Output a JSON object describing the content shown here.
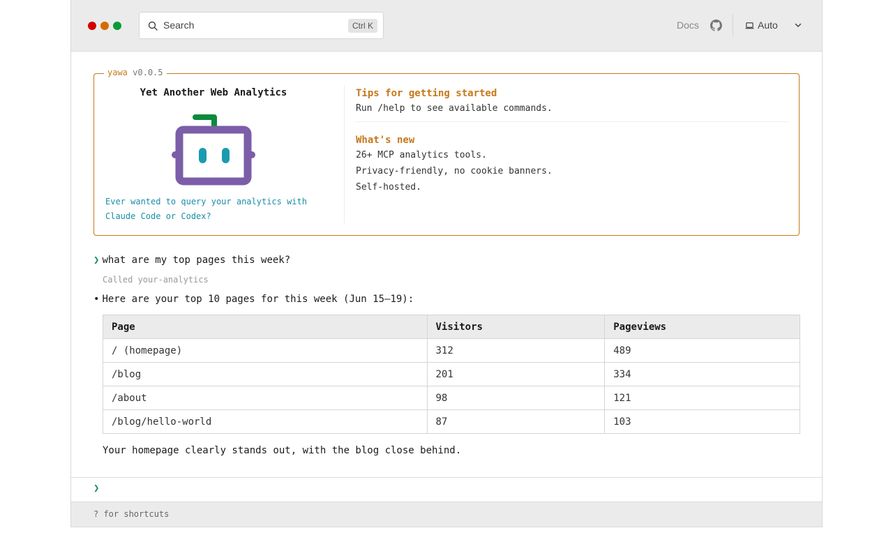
{
  "titlebar": {
    "window_controls": [
      {
        "name": "close",
        "color": "#d40000"
      },
      {
        "name": "minimize",
        "color": "#d46b00"
      },
      {
        "name": "maximize",
        "color": "#0a9a3a"
      }
    ],
    "search": {
      "placeholder": "Search",
      "icon": "search-icon",
      "shortcut": "Ctrl K"
    },
    "docs_label": "Docs",
    "github_icon": "github-icon",
    "theme": {
      "icon": "laptop-icon",
      "label": "Auto",
      "chevron": "chevron-down-icon"
    }
  },
  "welcome": {
    "app_name": "yawa",
    "version": "v0.0.5",
    "title": "Yet Another Web Analytics",
    "tagline": "Ever wanted to query your analytics with Claude Code or Codex?",
    "tips_heading": "Tips for getting started",
    "tips_lines": [
      "Run /help to see available commands."
    ],
    "news_heading": "What's new",
    "news_lines": [
      "26+ MCP analytics tools.",
      "Privacy-friendly, no cookie banners.",
      "Self-hosted."
    ],
    "colors": {
      "border": "#c7781a",
      "accent": "#c7781a",
      "tagline": "#1a8fa8",
      "robot_body": "#7b5ea7",
      "robot_eyes": "#1a9bb0",
      "robot_antenna": "#0a8a3a"
    }
  },
  "conversation": {
    "prompt": "what are my top pages this week?",
    "tool_call": "Called your-analytics",
    "answer": "Here are your top 10 pages for this week (Jun 15–19):",
    "table": {
      "headers": [
        "Page",
        "Visitors",
        "Pageviews"
      ],
      "rows": [
        [
          "/ (homepage)",
          "312",
          "489"
        ],
        [
          "/blog",
          "201",
          "334"
        ],
        [
          "/about",
          "98",
          "121"
        ],
        [
          "/blog/hello-world",
          "87",
          "103"
        ]
      ]
    },
    "summary": "Your homepage clearly stands out, with the blog close behind."
  },
  "input": {
    "caret": "❯",
    "value": ""
  },
  "footer": {
    "hint": "? for shortcuts"
  }
}
